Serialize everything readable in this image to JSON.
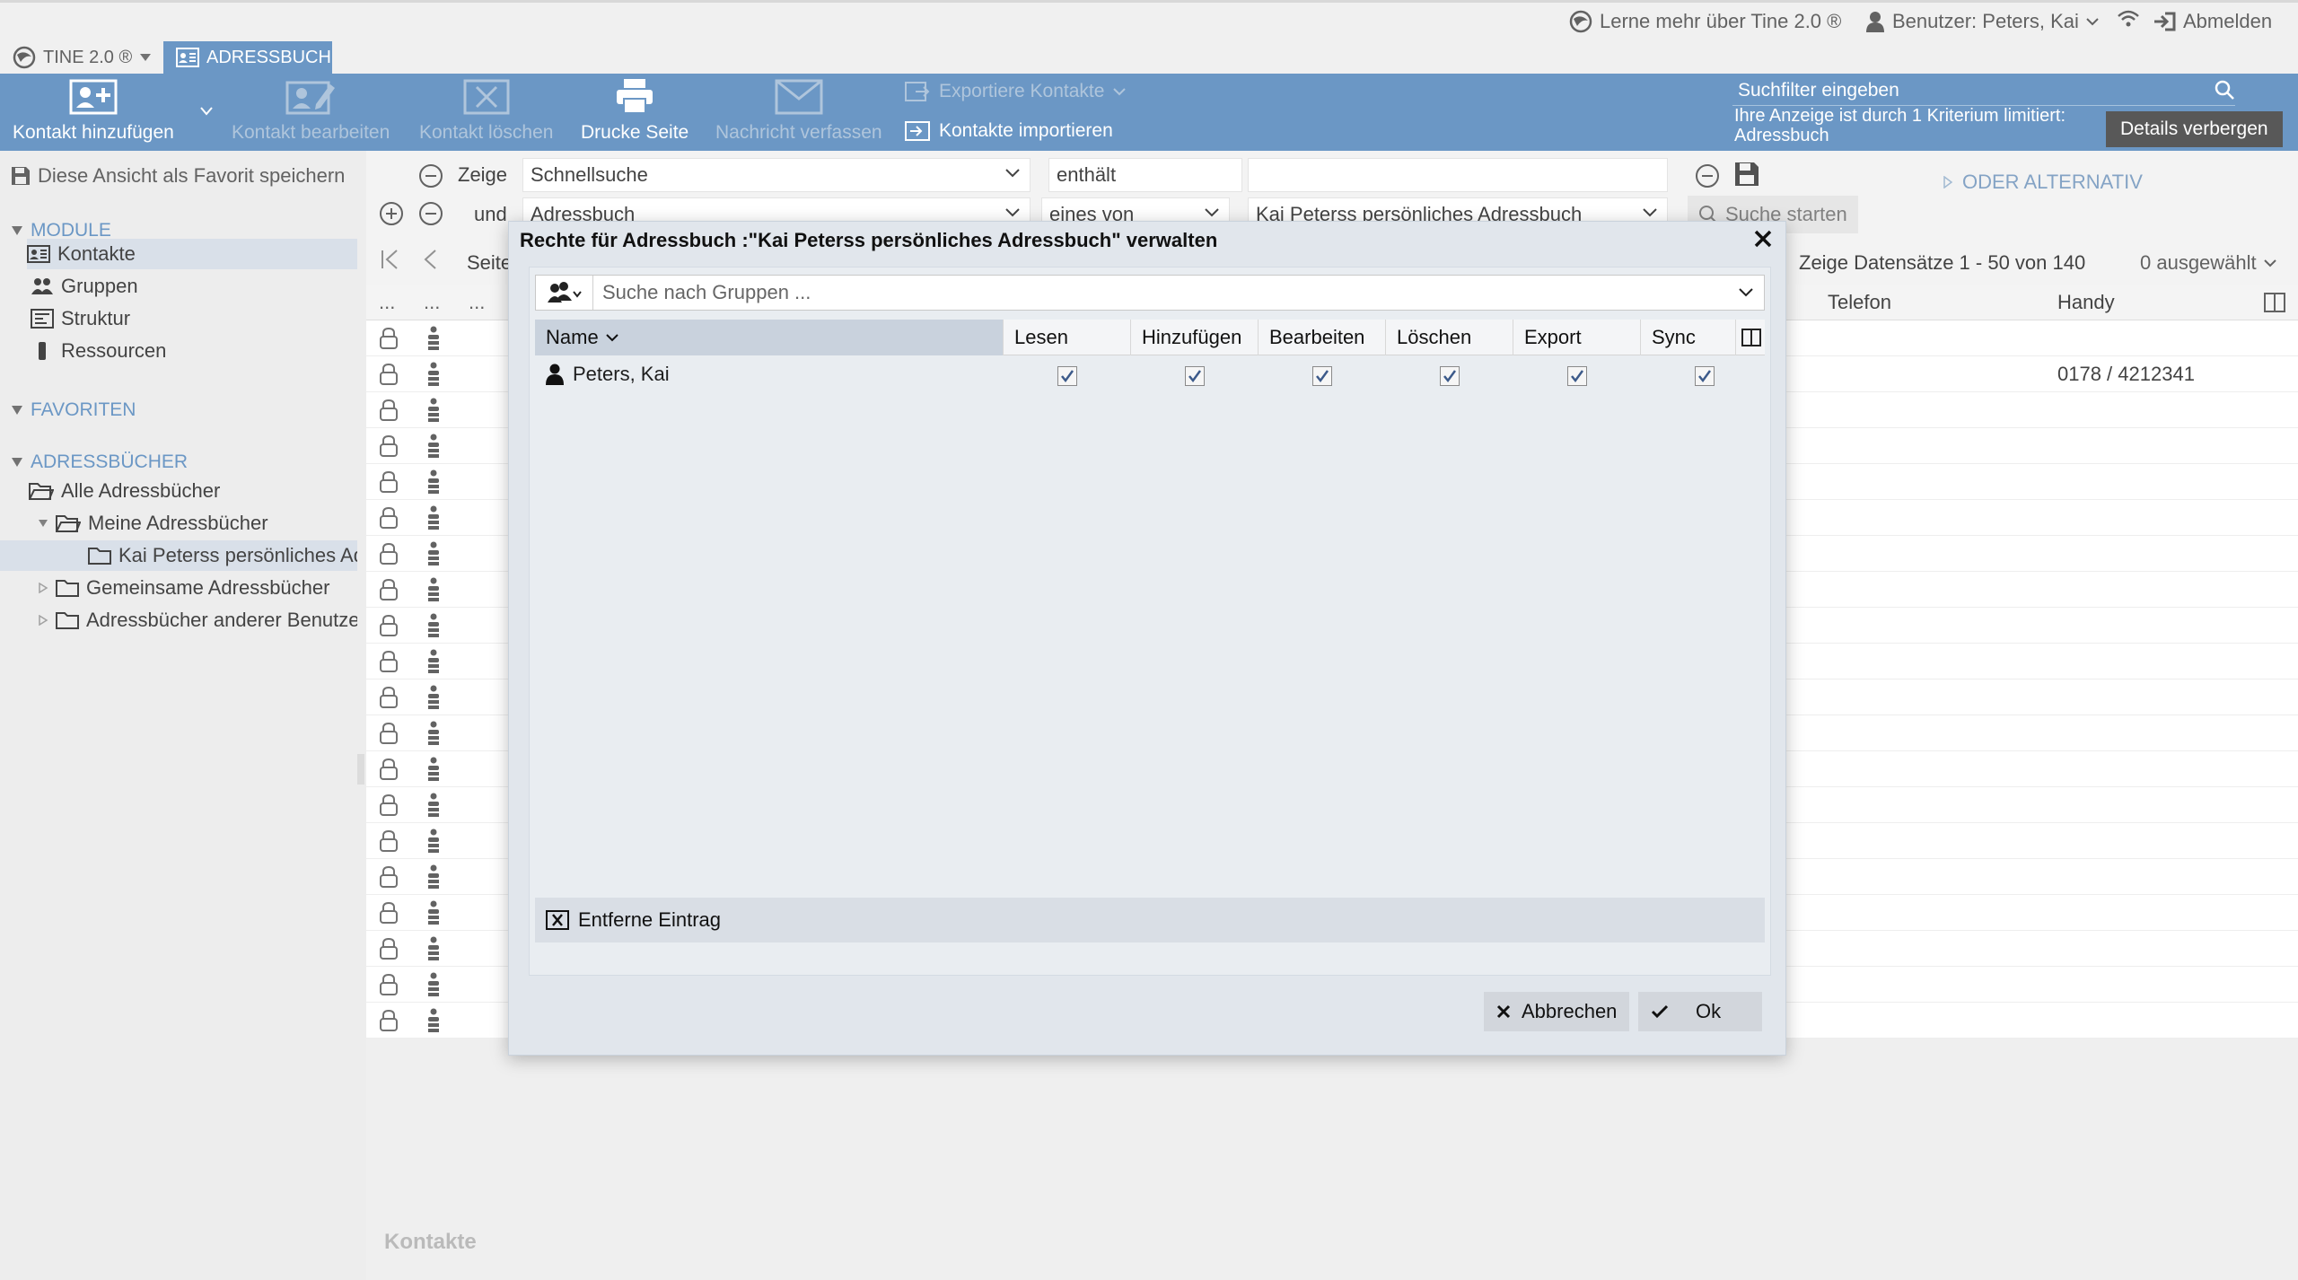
{
  "header": {
    "learn_more": "Lerne mehr über Tine 2.0 ®",
    "user_label": "Benutzer: Peters, Kai",
    "logout": "Abmelden"
  },
  "apptabs": {
    "tine": "TINE 2.0 ®",
    "adressbuch": "ADRESSBUCH"
  },
  "toolbar": {
    "add_contact": "Kontakt hinzufügen",
    "edit_contact": "Kontakt bearbeiten",
    "delete_contact": "Kontakt löschen",
    "print_page": "Drucke Seite",
    "compose_message": "Nachricht verfassen",
    "export_contacts": "Exportiere Kontakte",
    "import_contacts": "Kontakte importieren"
  },
  "search": {
    "placeholder": "Suchfilter eingeben",
    "filter_info": "Ihre Anzeige ist durch 1 Kriterium limitiert:",
    "filter_value": "Adressbuch",
    "details_button": "Details verbergen"
  },
  "sidebar": {
    "save_favorite": "Diese Ansicht als Favorit speichern",
    "modules_header": "MODULE",
    "modules": [
      "Kontakte",
      "Gruppen",
      "Struktur",
      "Ressourcen"
    ],
    "favorites_header": "FAVORITEN",
    "addressbooks_header": "ADRESSBÜCHER",
    "all_books": "Alle Adressbücher",
    "my_books": "Meine Adressbücher",
    "personal_book": "Kai Peterss persönliches Adressbuch",
    "shared_books": "Gemeinsame Adressbücher",
    "other_users_books": "Adressbücher anderer Benutzer"
  },
  "filter": {
    "row1_label": "Zeige",
    "row1_field": "Schnellsuche",
    "row1_op": "enthält",
    "row1_value": "",
    "row2_label": "und",
    "row2_field": "Adressbuch",
    "row2_op": "eines von",
    "row2_value": "Kai Peterss persönliches Adressbuch",
    "or_alternative": "ODER ALTERNATIV",
    "start_search": "Suche starten"
  },
  "grid": {
    "page_label": "Seite",
    "records_info": "Zeige Datensätze 1 - 50 von 140",
    "selected": "0 ausgewählt",
    "col_dots": "...",
    "col_phone": "Telefon",
    "col_mobile": "Handy",
    "first_row_mobile": "0178 / 4212341",
    "footer_label": "Kontakte"
  },
  "dialog": {
    "title": "Rechte für Adressbuch :\"Kai Peterss persönliches Adressbuch\" verwalten",
    "group_search_placeholder": "Suche nach Gruppen ...",
    "columns": {
      "name": "Name",
      "read": "Lesen",
      "add": "Hinzufügen",
      "edit": "Bearbeiten",
      "delete": "Löschen",
      "export": "Export",
      "sync": "Sync"
    },
    "rows": [
      {
        "name": "Peters, Kai",
        "read": true,
        "add": true,
        "edit": true,
        "delete": true,
        "export": true,
        "sync": true
      }
    ],
    "remove_entry": "Entferne Eintrag",
    "cancel": "Abbrechen",
    "ok": "Ok"
  },
  "colors": {
    "toolbar_blue": "#5f8fc0",
    "section_blue": "#5f8fc0",
    "selected_row": "#d6dee8"
  }
}
